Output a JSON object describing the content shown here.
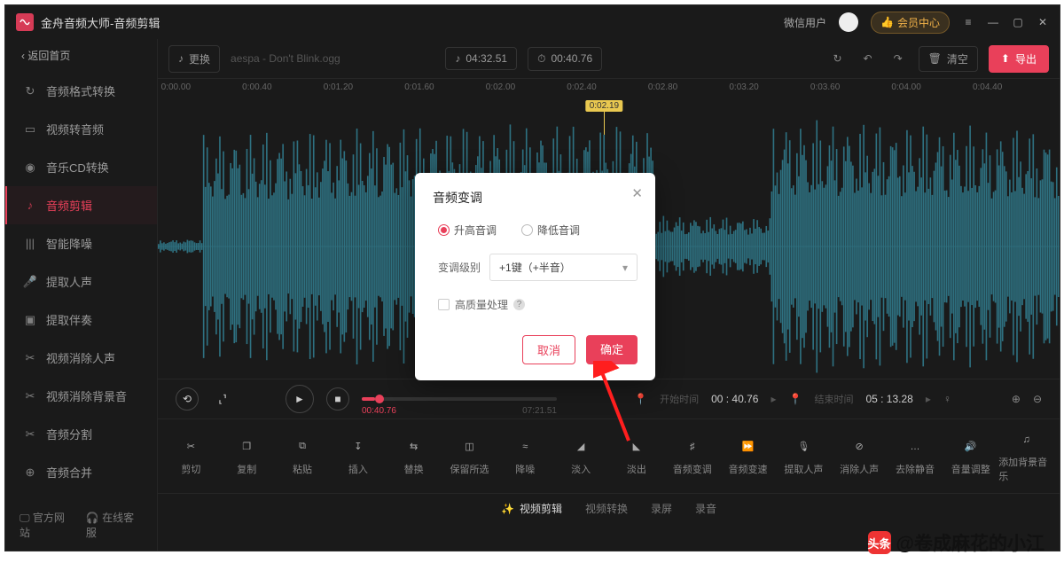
{
  "titlebar": {
    "app_title": "金舟音频大师-音频剪辑",
    "user_label": "微信用户",
    "vip_label": "会员中心"
  },
  "sidebar": {
    "back_label": "‹  返回首页",
    "items": [
      {
        "label": "音频格式转换",
        "icon": "refresh-icon"
      },
      {
        "label": "视频转音频",
        "icon": "film-icon"
      },
      {
        "label": "音乐CD转换",
        "icon": "disc-icon"
      },
      {
        "label": "音频剪辑",
        "icon": "wave-icon"
      },
      {
        "label": "智能降噪",
        "icon": "bars-icon"
      },
      {
        "label": "提取人声",
        "icon": "mic-icon"
      },
      {
        "label": "提取伴奏",
        "icon": "extract-icon"
      },
      {
        "label": "视频消除人声",
        "icon": "scissors-icon"
      },
      {
        "label": "视频消除背景音",
        "icon": "scissors-icon"
      },
      {
        "label": "音频分割",
        "icon": "scissors-icon"
      },
      {
        "label": "音频合并",
        "icon": "merge-icon"
      }
    ],
    "footer": {
      "site": "官方网站",
      "support": "在线客服"
    }
  },
  "toolbar": {
    "swap_label": "更换",
    "filename": "aespa - Don't Blink.ogg",
    "total_time": "04:32.51",
    "selection_time": "00:40.76",
    "clear_label": "清空",
    "export_label": "导出"
  },
  "ruler": {
    "ticks": [
      "0:00.00",
      "0:00.40",
      "0:01.20",
      "0:01.60",
      "0:02.00",
      "0:02.40",
      "0:02.80",
      "0:03.20",
      "0:03.60",
      "0:04.00",
      "0:04.40"
    ],
    "playhead_label": "0:02.19"
  },
  "transport": {
    "current_time": "00:40.76",
    "end_time": "07:21.51",
    "start_label": "开始时间",
    "start_value": "00 : 40.76",
    "finish_label": "结束时间",
    "finish_value": "05 : 13.28"
  },
  "tools": {
    "items": [
      "剪切",
      "复制",
      "粘贴",
      "插入",
      "替换",
      "保留所选",
      "降噪",
      "淡入",
      "淡出",
      "音频变调",
      "音频变速",
      "提取人声",
      "消除人声",
      "去除静音",
      "音量调整",
      "添加背景音乐"
    ]
  },
  "bottom_nav": {
    "items": [
      "视频剪辑",
      "视频转换",
      "录屏",
      "录音"
    ]
  },
  "modal": {
    "title": "音频变调",
    "radio_up": "升高音调",
    "radio_down": "降低音调",
    "level_label": "变调级别",
    "level_value": "+1键（+半音）",
    "hq_label": "高质量处理",
    "cancel": "取消",
    "ok": "确定"
  },
  "watermark": {
    "prefix": "头条",
    "text": "@卷成麻花的小江"
  }
}
